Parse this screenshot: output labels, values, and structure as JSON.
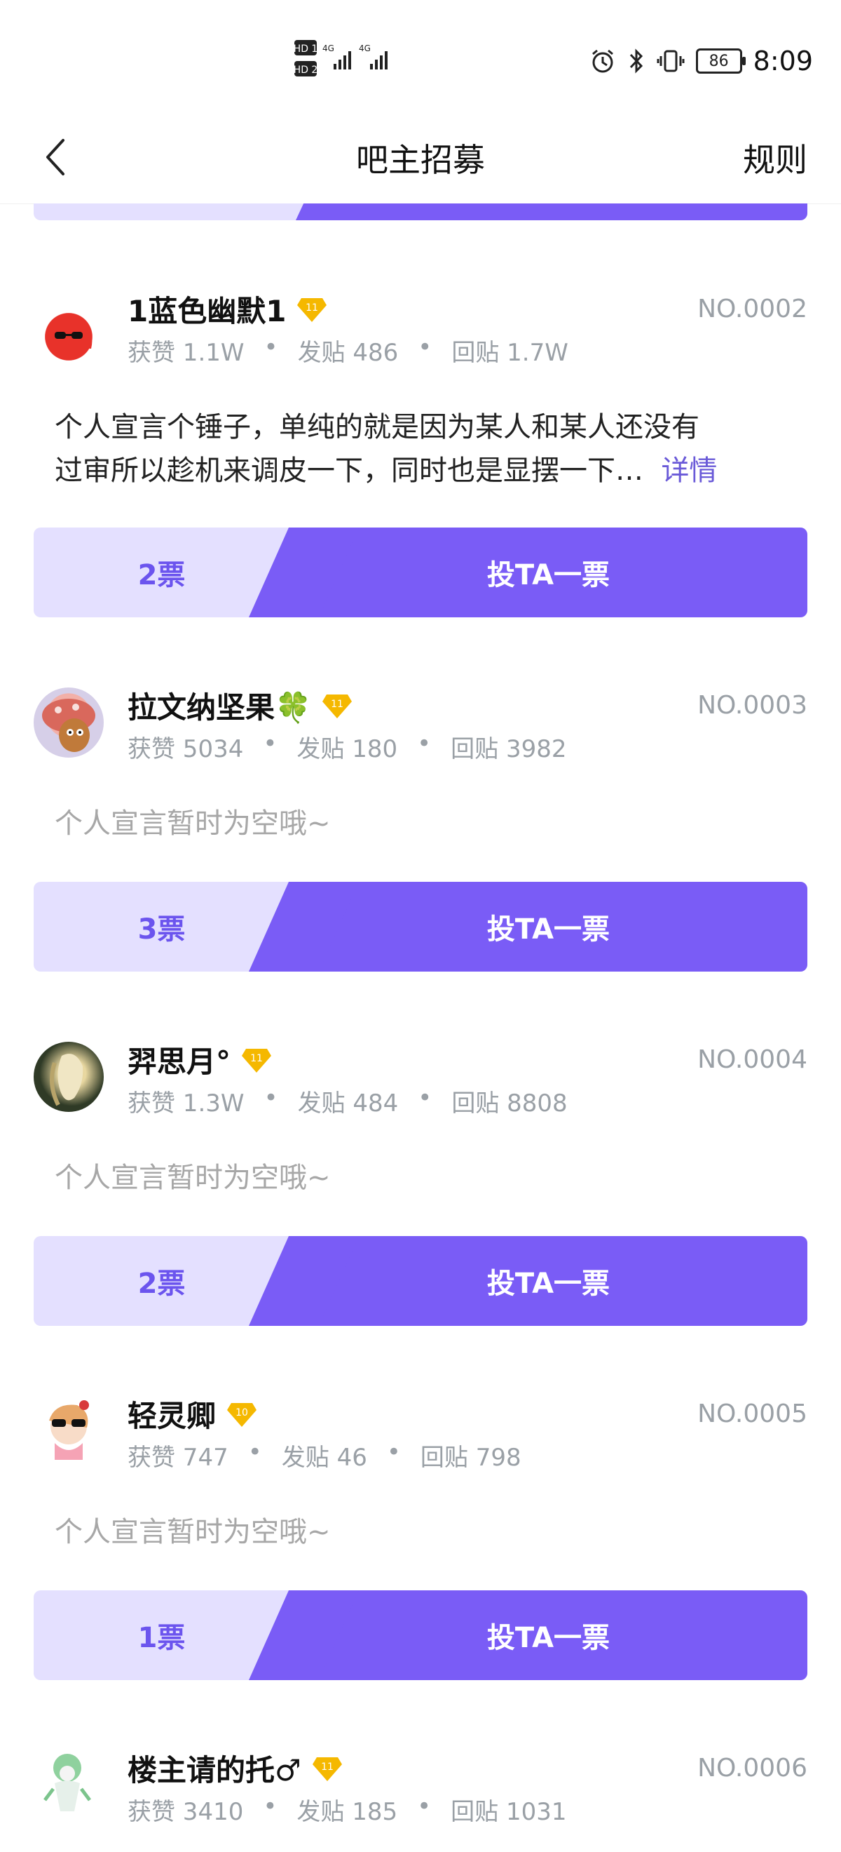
{
  "status_bar": {
    "time": "8:09",
    "battery": "86",
    "sim1": "HD 1",
    "sim2": "HD 2",
    "net": "4G"
  },
  "header": {
    "title": "吧主招募",
    "rules_label": "规则"
  },
  "colors": {
    "accent": "#7a5cf6",
    "accent_light": "#e4e0ff",
    "badge_gold": "#f5b800"
  },
  "candidates": [
    {
      "name": "1蓝色幽默1",
      "level": "11",
      "no": "NO.0002",
      "likes": "获赞 1.1W",
      "posts": "发贴 486",
      "replies": "回贴 1.7W",
      "manifesto_line1": "个人宣言个锤子，单纯的就是因为某人和某人还没有",
      "manifesto_line2": "过审所以趁机来调皮一下，同时也是显摆一下…",
      "detail": "详情",
      "votes": "2票",
      "vote_button": "投TA一票"
    },
    {
      "name": "拉文纳坚果🍀",
      "level": "11",
      "no": "NO.0003",
      "likes": "获赞 5034",
      "posts": "发贴 180",
      "replies": "回贴 3982",
      "manifesto": "个人宣言暂时为空哦~",
      "votes": "3票",
      "vote_button": "投TA一票"
    },
    {
      "name": "羿思月°",
      "level": "11",
      "no": "NO.0004",
      "likes": "获赞 1.3W",
      "posts": "发贴 484",
      "replies": "回贴 8808",
      "manifesto": "个人宣言暂时为空哦~",
      "votes": "2票",
      "vote_button": "投TA一票"
    },
    {
      "name": "轻灵卿",
      "level": "10",
      "no": "NO.0005",
      "likes": "获赞 747",
      "posts": "发贴 46",
      "replies": "回贴 798",
      "manifesto": "个人宣言暂时为空哦~",
      "votes": "1票",
      "vote_button": "投TA一票"
    },
    {
      "name": "楼主请的托♂",
      "level": "11",
      "no": "NO.0006",
      "likes": "获赞 3410",
      "posts": "发贴 185",
      "replies": "回贴 1031"
    }
  ],
  "dot": "•"
}
